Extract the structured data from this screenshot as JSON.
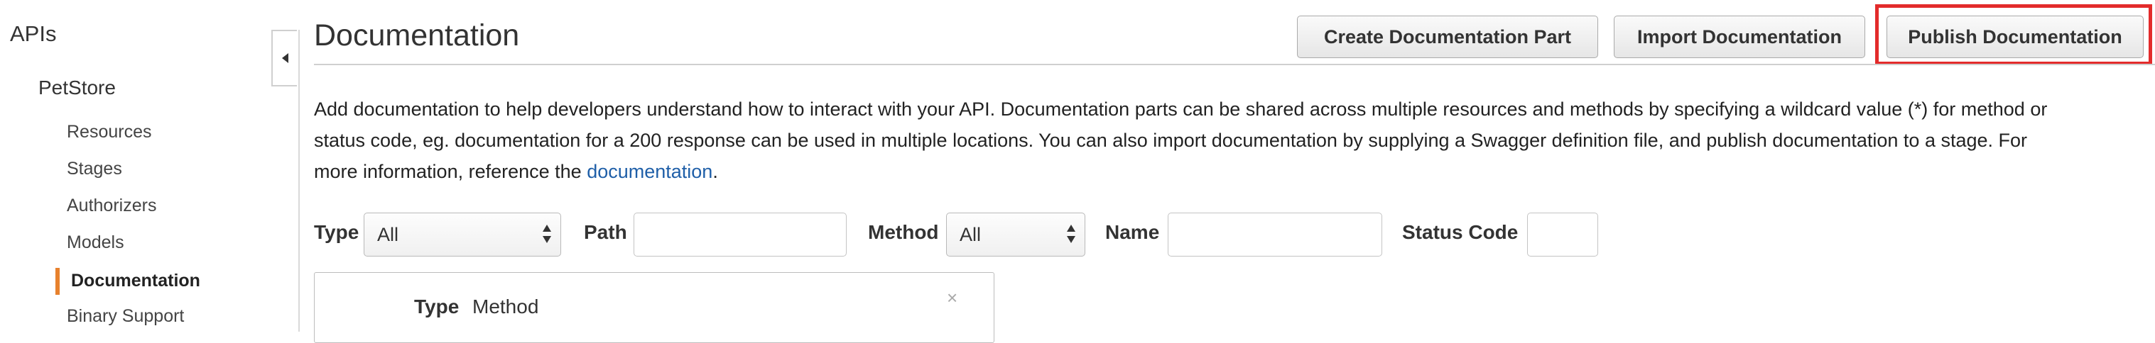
{
  "sidebar": {
    "title": "APIs",
    "api_name": "PetStore",
    "items": [
      {
        "label": "Resources"
      },
      {
        "label": "Stages"
      },
      {
        "label": "Authorizers"
      },
      {
        "label": "Models"
      },
      {
        "label": "Documentation",
        "active": true
      },
      {
        "label": "Binary Support"
      }
    ],
    "collapse_icon": "caret-left-icon",
    "active_color": "#e7812d"
  },
  "header": {
    "title": "Documentation",
    "buttons": {
      "create": "Create Documentation Part",
      "import": "Import Documentation",
      "publish": "Publish Documentation"
    },
    "highlight_color": "#e32b2b"
  },
  "description": {
    "line1": "Add documentation to help developers understand how to interact with your API. Documentation parts can be shared across multiple resources and methods by specifying a wildcard value (*) for method or",
    "line2": "status code, eg. documentation for a 200 response can be used in multiple locations. You can also import documentation by supplying a Swagger definition file, and publish documentation to a stage. For",
    "line3_prefix": "more information, reference the ",
    "link_text": "documentation",
    "line3_suffix": ".",
    "link_color": "#1f5fa8"
  },
  "filters": {
    "type_label": "Type",
    "type_value": "All",
    "path_label": "Path",
    "path_value": "",
    "method_label": "Method",
    "method_value": "All",
    "name_label": "Name",
    "name_value": "",
    "status_label": "Status Code",
    "status_value": ""
  },
  "card": {
    "type_label": "Type",
    "type_value": "Method",
    "close_glyph": "×"
  }
}
